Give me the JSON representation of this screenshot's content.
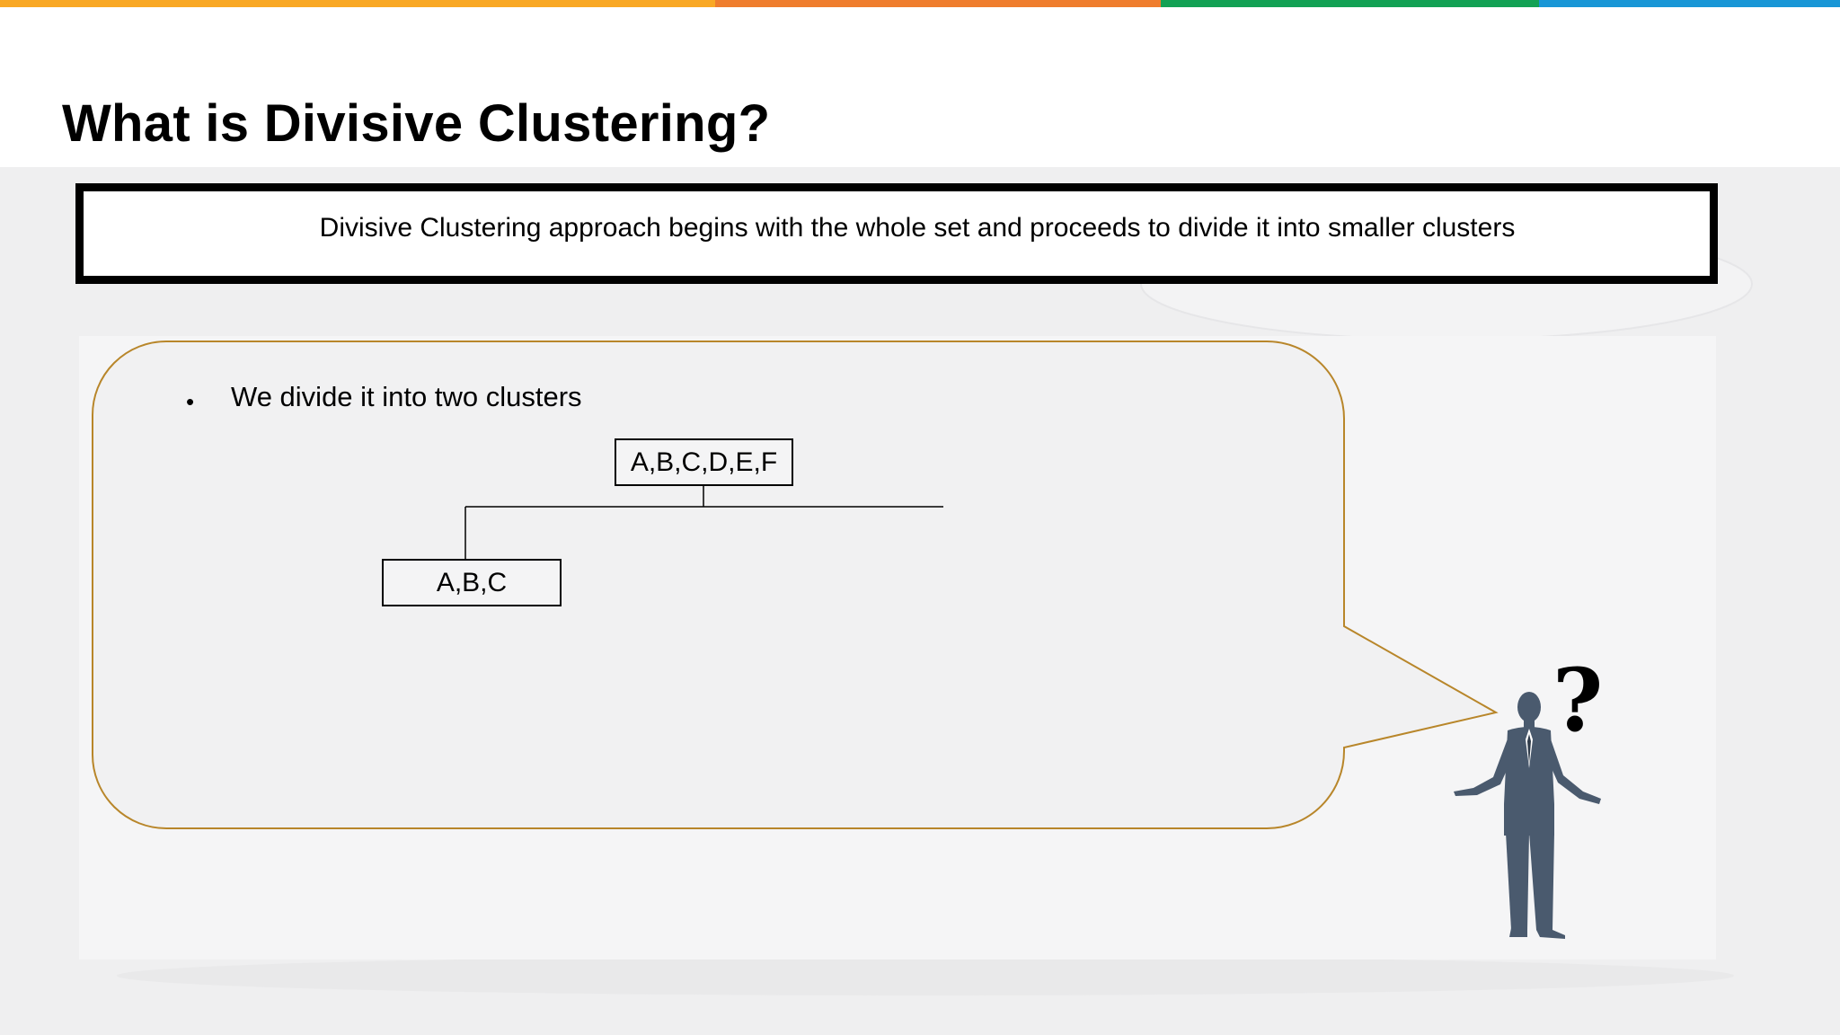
{
  "slide": {
    "title": "What is Divisive Clustering?",
    "top_bar_colors": [
      "#f9a825",
      "#ef7d2d",
      "#13a154",
      "#1996d6"
    ]
  },
  "definition": {
    "text": "Divisive Clustering approach begins with the whole set and proceeds to divide it into smaller clusters"
  },
  "content": {
    "bullet": "We divide it into two clusters",
    "tree": {
      "root": "A,B,C,D,E,F",
      "children": [
        "A,B,C"
      ]
    }
  },
  "colors": {
    "bubble_border": "#b8862a",
    "figure": "#4a5a6e"
  },
  "icons": {
    "figure": "thinking-businessman-icon",
    "question": "question-mark-icon"
  }
}
